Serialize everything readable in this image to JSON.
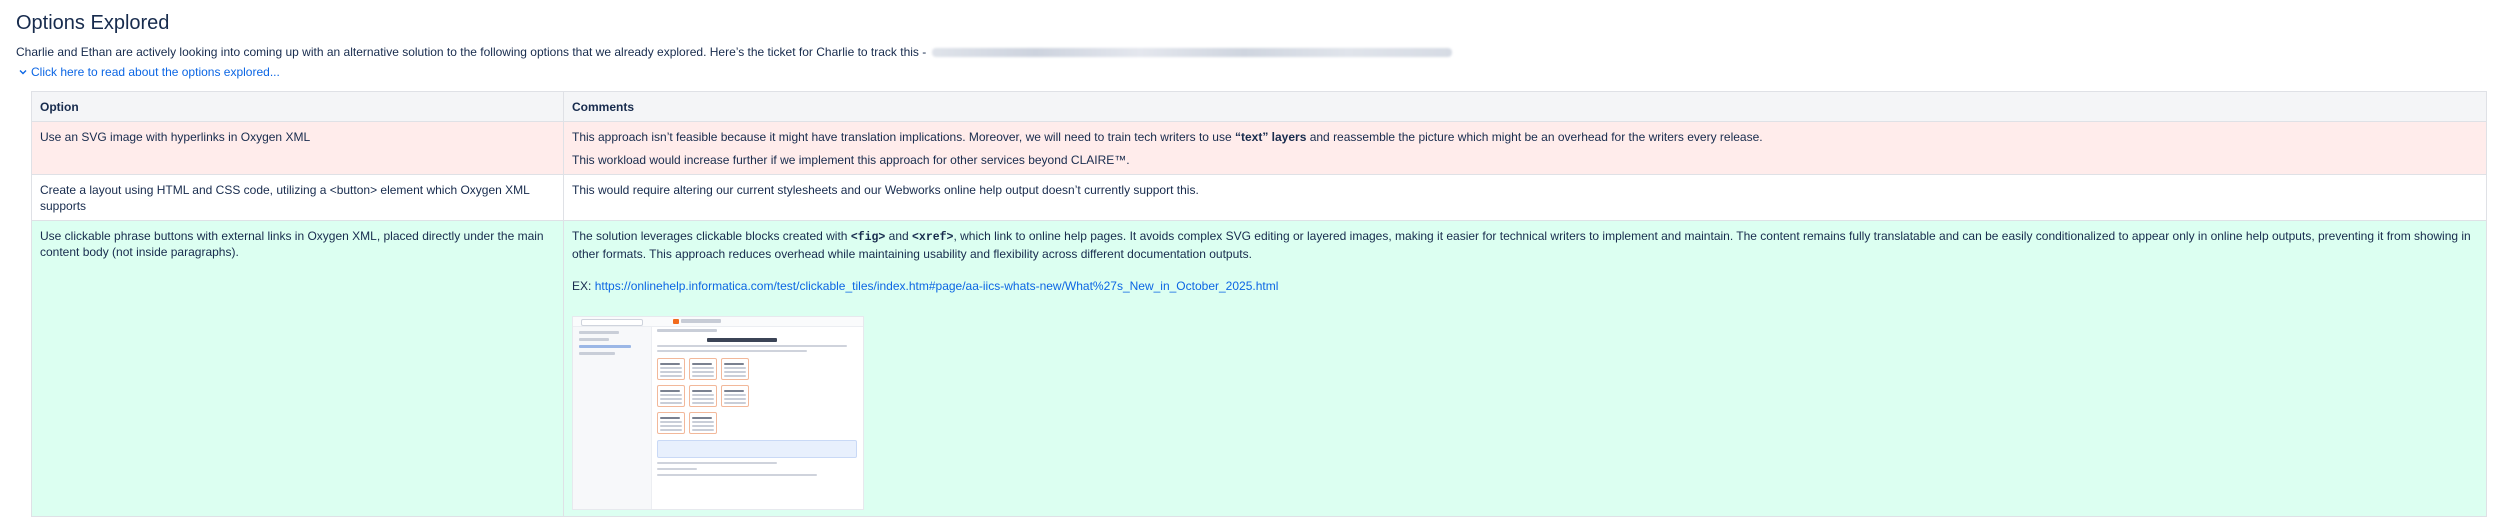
{
  "page": {
    "title": "Options Explored",
    "intro": "Charlie and Ethan are actively looking into coming up with an alternative solution to the following options that we already explored. Here’s the ticket for Charlie to track this -",
    "expand_label": "Click here to read about the options explored..."
  },
  "table": {
    "headers": [
      "Option",
      "Comments"
    ],
    "rows": [
      {
        "option": "Use an SVG image with hyperlinks in Oxygen XML",
        "c1_pre": "This approach isn’t feasible because it might have translation implications. Moreover, we will need to train tech writers to use ",
        "c1_bold": "“text” layers",
        "c1_post": " and reassemble the picture which might be an overhead for the writers every release.",
        "c2": "This workload would increase further if we implement this approach for other services beyond CLAIRE™."
      },
      {
        "option": "Create a layout using HTML and CSS code, utilizing a <button> element which Oxygen XML supports",
        "comment": "This would require altering our current stylesheets and our Webworks online help output doesn’t currently support this."
      },
      {
        "option": "Use clickable phrase buttons with external links in Oxygen XML, placed directly under the main content body (not inside paragraphs).",
        "c_pre": "The solution leverages clickable blocks created with ",
        "code1": "<fig>",
        "c_and": " and ",
        "code2": "<xref>",
        "c_post": ", which link to online help pages. It avoids complex SVG editing or layered images, making it easier for technical writers to implement and maintain. The content remains fully translatable and can be easily conditionalized to appear only in online help outputs, preventing it from showing in other formats. This approach reduces overhead while maintaining usability and flexibility across different documentation outputs.",
        "ex_label": "EX: ",
        "ex_link": "https://onlinehelp.informatica.com/test/clickable_tiles/index.htm#page/aa-iics-whats-new/What%27s_New_in_October_2025.html"
      }
    ]
  },
  "colors": {
    "row_red": "#ffeceb",
    "row_green": "#dcfff1",
    "header_bg": "#f4f5f7",
    "link": "#0c66e4",
    "text": "#172b4d"
  },
  "icons": {
    "expand": "chevron-down-icon"
  }
}
